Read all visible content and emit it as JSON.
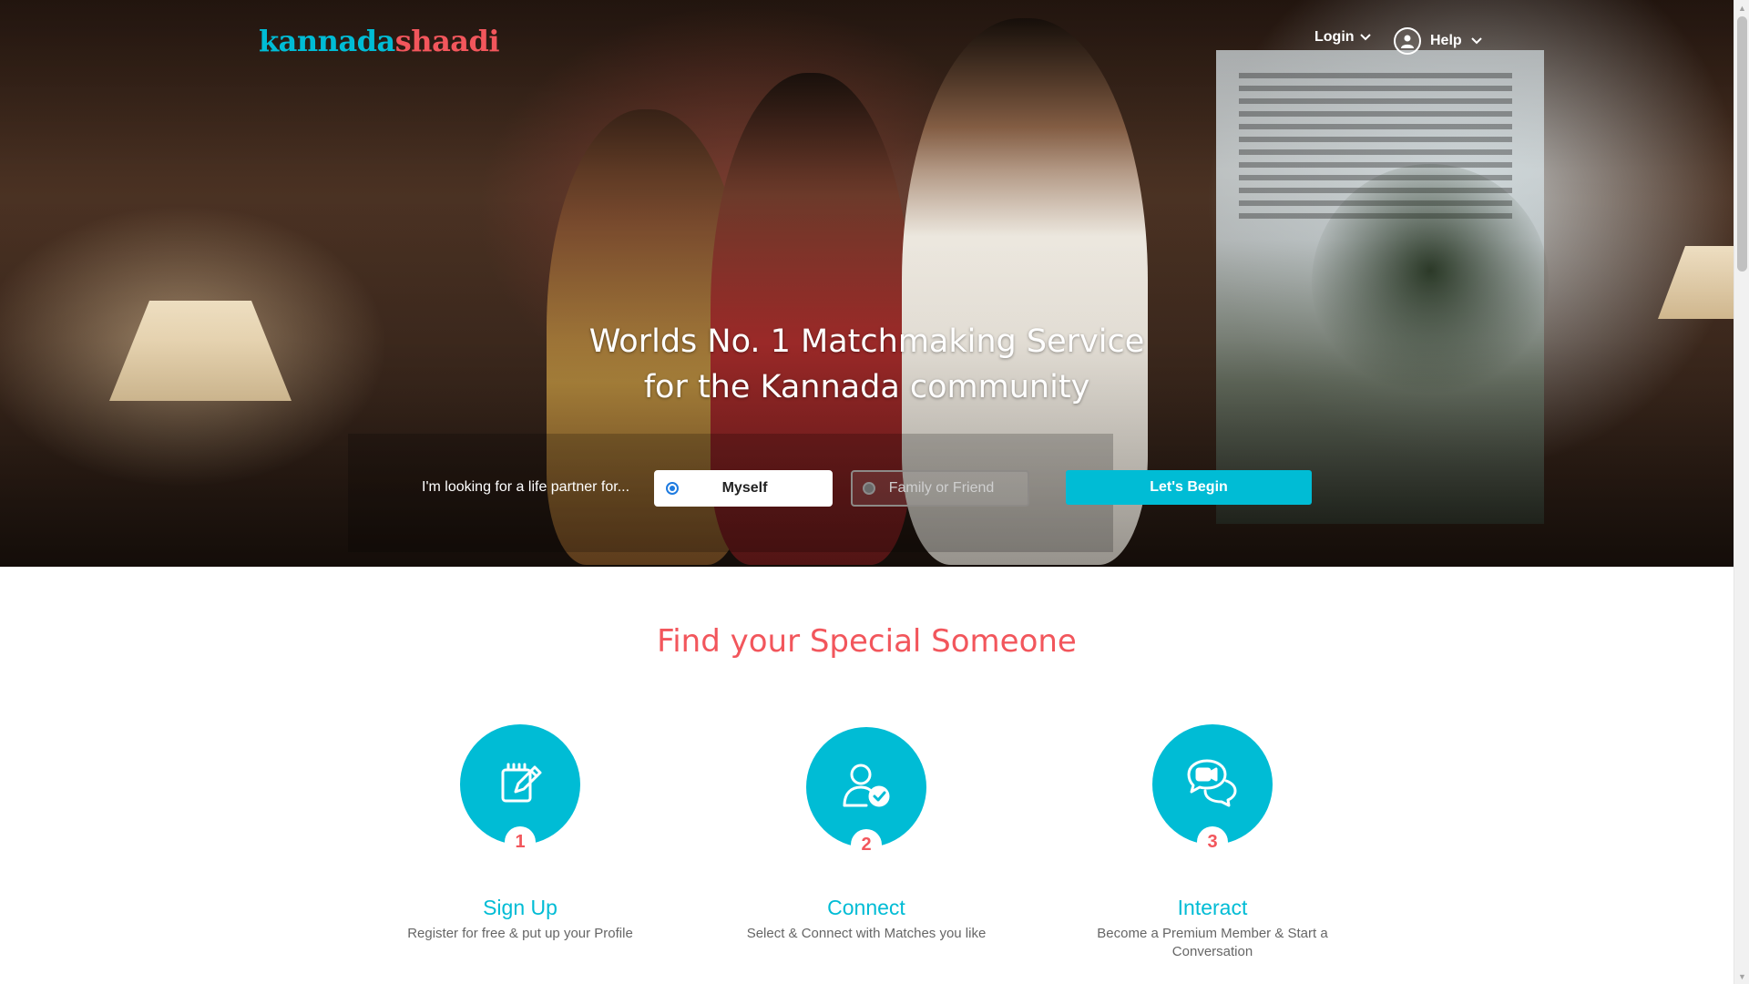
{
  "header": {
    "logo_part1": "kannada",
    "logo_part2": "shaadi",
    "login_label": "Login",
    "help_label": "Help"
  },
  "hero": {
    "headline_line1": "Worlds No. 1 Matchmaking Service",
    "headline_line2": "for the Kannada community",
    "search_prompt": "I'm looking for a life partner for...",
    "options": [
      {
        "label": "Myself",
        "selected": true
      },
      {
        "label": "Family or Friend",
        "selected": false
      }
    ],
    "cta_label": "Let's Begin"
  },
  "how_it_works": {
    "title": "Find your Special Someone",
    "steps": [
      {
        "number": "1",
        "icon": "edit-profile-icon",
        "title": "Sign Up",
        "description": "Register for free & put up your Profile"
      },
      {
        "number": "2",
        "icon": "connect-user-check-icon",
        "title": "Connect",
        "description": "Select & Connect with Matches you like"
      },
      {
        "number": "3",
        "icon": "chat-video-icon",
        "title": "Interact",
        "description": "Become a Premium Member & Start a Conversation"
      }
    ]
  },
  "colors": {
    "accent_teal": "#00bcd5",
    "accent_coral": "#f2565c"
  }
}
